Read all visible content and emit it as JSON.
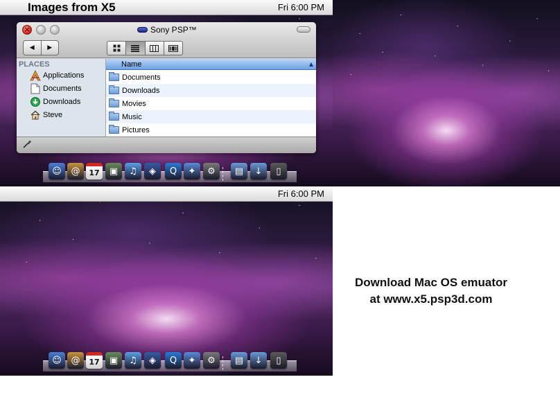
{
  "top_screen": {
    "menubar": {
      "title": "Images from X5",
      "clock": "Fri 6:00 PM"
    },
    "window": {
      "title": "Sony PSP™",
      "sidebar": {
        "header": "PLACES",
        "items": [
          {
            "label": "Applications",
            "icon": "applications-icon"
          },
          {
            "label": "Documents",
            "icon": "document-icon"
          },
          {
            "label": "Downloads",
            "icon": "download-icon"
          },
          {
            "label": "Steve",
            "icon": "home-icon"
          }
        ]
      },
      "column_header": "Name",
      "files": [
        {
          "name": "Documents"
        },
        {
          "name": "Downloads"
        },
        {
          "name": "Movies"
        },
        {
          "name": "Music"
        },
        {
          "name": "Pictures"
        }
      ]
    }
  },
  "bottom_screen": {
    "menubar": {
      "clock": "Fri 6:00 PM"
    }
  },
  "dock": {
    "apps": [
      {
        "icon": "finder-icon",
        "color": "#4a7ed8"
      },
      {
        "icon": "address-book-icon",
        "color": "#c8943c"
      },
      {
        "icon": "ical-icon",
        "color": "#e8e8e8",
        "text": "17"
      },
      {
        "icon": "iphoto-icon",
        "color": "#6a8a5a"
      },
      {
        "icon": "itunes-icon",
        "color": "#5aa0e8"
      },
      {
        "icon": "preview-icon",
        "color": "#3a5aa8"
      },
      {
        "icon": "quicktime-icon",
        "color": "#2a7ad8"
      },
      {
        "icon": "safari-icon",
        "color": "#5a8ad8"
      },
      {
        "icon": "system-preferences-icon",
        "color": "#7a7a7a"
      },
      {
        "icon": "applications-folder-icon",
        "color": "#6a9ad8"
      },
      {
        "icon": "downloads-folder-icon",
        "color": "#6a9ad8"
      },
      {
        "icon": "trash-icon",
        "color": "#5a5a5a"
      }
    ]
  },
  "promo": {
    "line1": "Download Mac OS emuator",
    "line2": "at www.x5.psp3d.com"
  }
}
